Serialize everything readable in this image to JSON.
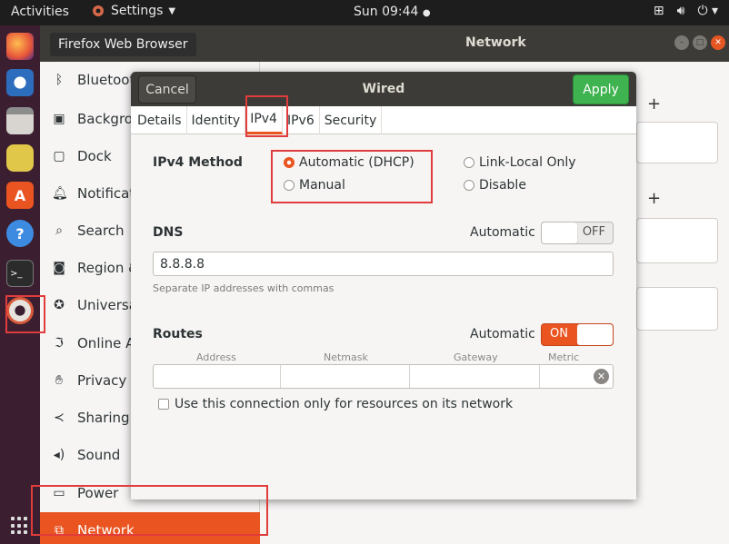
{
  "topbar": {
    "activities": "Activities",
    "app_menu": "Settings",
    "clock": "Sun 09:44"
  },
  "tooltip": "Firefox Web Browser",
  "dock": {
    "items": [
      "firefox-icon",
      "thunderbird-icon",
      "files-icon",
      "rhythmbox-icon",
      "software-icon",
      "help-icon",
      "terminal-icon",
      "settings-icon"
    ]
  },
  "settings_window": {
    "title": "Network",
    "sidebar": [
      {
        "label": "Bluetooth",
        "icon": "bluetooth-icon"
      },
      {
        "label": "Backgrou",
        "icon": "background-icon"
      },
      {
        "label": "Dock",
        "icon": "dock-icon"
      },
      {
        "label": "Notificat",
        "icon": "bell-icon"
      },
      {
        "label": "Search",
        "icon": "search-icon"
      },
      {
        "label": "Region &",
        "icon": "region-icon"
      },
      {
        "label": "Universa",
        "icon": "accessibility-icon"
      },
      {
        "label": "Online Ac",
        "icon": "online-accounts-icon"
      },
      {
        "label": "Privacy",
        "icon": "privacy-icon"
      },
      {
        "label": "Sharing",
        "icon": "share-icon"
      },
      {
        "label": "Sound",
        "icon": "sound-icon"
      },
      {
        "label": "Power",
        "icon": "power-icon"
      },
      {
        "label": "Network",
        "icon": "network-icon"
      }
    ]
  },
  "dialog": {
    "title": "Wired",
    "cancel_label": "Cancel",
    "apply_label": "Apply",
    "tabs": [
      "Details",
      "Identity",
      "IPv4",
      "IPv6",
      "Security"
    ],
    "active_tab": "IPv4",
    "ipv4_method_label": "IPv4 Method",
    "methods": {
      "automatic": "Automatic (DHCP)",
      "manual": "Manual",
      "link_local": "Link-Local Only",
      "disable": "Disable",
      "selected": "Automatic (DHCP)"
    },
    "dns": {
      "label": "DNS",
      "automatic_label": "Automatic",
      "toggle_state": "OFF",
      "value": "8.8.8.8",
      "hint": "Separate IP addresses with commas"
    },
    "routes": {
      "label": "Routes",
      "automatic_label": "Automatic",
      "toggle_state": "ON",
      "columns": [
        "Address",
        "Netmask",
        "Gateway",
        "Metric"
      ]
    },
    "only_local_label": "Use this connection only for resources on its network"
  },
  "colors": {
    "accent": "#e95420",
    "apply_green": "#3eb34f",
    "highlight_red": "#e03c3c"
  }
}
